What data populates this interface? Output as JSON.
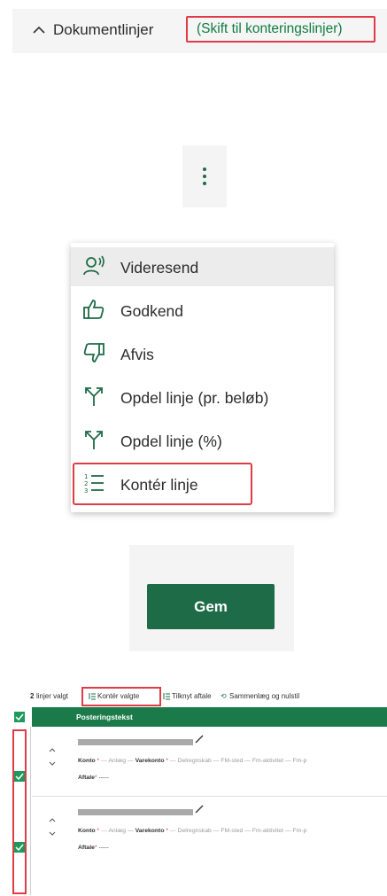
{
  "section": {
    "title": "Dokumentlinjer",
    "switch_link": "(Skift til konteringslinjer)"
  },
  "menu": {
    "items": [
      {
        "label": "Videresend",
        "icon": "forward-user-icon"
      },
      {
        "label": "Godkend",
        "icon": "thumbs-up-icon"
      },
      {
        "label": "Afvis",
        "icon": "thumbs-down-icon"
      },
      {
        "label": "Opdel linje (pr. beløb)",
        "icon": "split-icon"
      },
      {
        "label": "Opdel linje (%)",
        "icon": "split-icon"
      },
      {
        "label": "Kontér linje",
        "icon": "numbered-list-icon"
      }
    ]
  },
  "save_button": {
    "label": "Gem"
  },
  "grid": {
    "toolbar": {
      "selected_count": "2",
      "selected_text": "linjer valgt",
      "konter_valgte": "Kontér valgte",
      "tilknyt_aftale": "Tilknyt aftale",
      "sammenlaeg": "Sammenlæg og nulstil"
    },
    "header": {
      "posteringstekst": "Posteringstekst"
    },
    "row_fields": {
      "konto": "Konto",
      "dash": "---",
      "anlaeg": "Anlæg",
      "varekonto": "Varekonto",
      "delregnskab": "Delregnskab",
      "fm_sted": "FM-sted",
      "fm_aktivitet": "Fm-aktivitet",
      "fm_p": "Fm-p",
      "aftale": "Aftale",
      "aftale_value": "-----"
    }
  },
  "colors": {
    "brand_green": "#1d6b47",
    "highlight_red": "#e03c48",
    "header_green": "#1a7a4a"
  }
}
